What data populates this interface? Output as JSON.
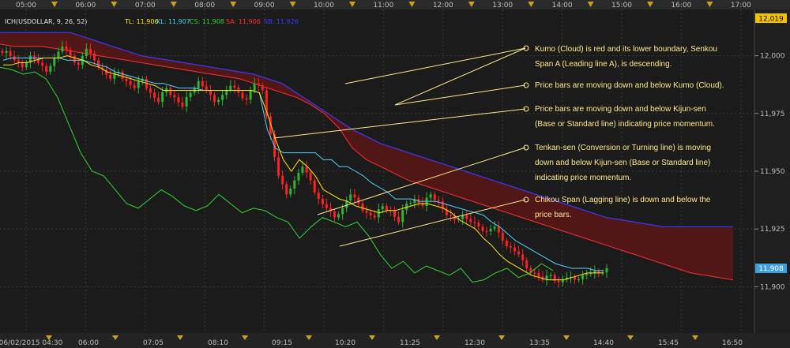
{
  "chart_data": {
    "type": "candlestick",
    "instrument_label": "ICH(USDOLLAR, 9, 26, 52)",
    "indicators": [
      {
        "key": "TL",
        "text": "TL: 11,906",
        "color": "#ffea00"
      },
      {
        "key": "KL",
        "text": "KL: 11,907",
        "color": "#4fd3ff"
      },
      {
        "key": "CS",
        "text": "CS: 11,908",
        "color": "#33d633"
      },
      {
        "key": "SA",
        "text": "SA: 11,906",
        "color": "#ff3030"
      },
      {
        "key": "SB",
        "text": "SB: 11,926",
        "color": "#3a3aff"
      }
    ],
    "top_time_ticks": [
      "05:00",
      "06:00",
      "07:00",
      "08:00",
      "09:00",
      "10:00",
      "11:00",
      "12:00",
      "13:00",
      "14:00",
      "15:00",
      "16:00",
      "17:00"
    ],
    "bottom_time_ticks": [
      "06/02/2015 04:30",
      "06:00",
      "07:05",
      "08:10",
      "09:15",
      "10:20",
      "11:25",
      "12:30",
      "13:35",
      "14:40",
      "15:45",
      "16:50"
    ],
    "y_ticks": [
      "12,000",
      "11,975",
      "11,950",
      "11,925",
      "11,900"
    ],
    "ylim": [
      11880,
      12020
    ],
    "last_price_tags": {
      "top": "12,019",
      "current": "11,908"
    },
    "annotations": [
      {
        "lines": [
          "Kumo (Cloud) is red and its lower boundary, Senkou",
          "Span A (Leading line A), is descending."
        ]
      },
      {
        "lines": [
          "Price bars are moving down and below Kumo (Cloud)."
        ]
      },
      {
        "lines": [
          "Price bars are moving down and below Kijun-sen",
          "(Base or Standard line) indicating price momentum."
        ]
      },
      {
        "lines": [
          "Tenkan-sen (Conversion or Turning line) is moving",
          "down and below Kijun-sen (Base or Standard line)",
          "indicating price momentum."
        ]
      },
      {
        "lines": [
          "Chikou Span (Lagging line) is down and below the",
          "price bars."
        ]
      }
    ],
    "colors": {
      "up": "#2fb52f",
      "down": "#ff2020",
      "cloud": "#5a1515",
      "tenkan": "#ffea00",
      "kijun": "#4fd3ff",
      "chikou": "#33d633",
      "senkou_a": "#ff3030",
      "senkou_b": "#3a3aff",
      "annotation": "#ffe98a"
    },
    "series": {
      "close_path": [
        12002,
        11998,
        11995,
        12000,
        11997,
        11993,
        11999,
        12004,
        12000,
        11996,
        12003,
        11998,
        11994,
        11990,
        11993,
        11989,
        11986,
        11990,
        11984,
        11980,
        11986,
        11982,
        11978,
        11984,
        11989,
        11985,
        11980,
        11983,
        11987,
        11984,
        11981,
        11988,
        11985,
        11966,
        11948,
        11940,
        11946,
        11952,
        11946,
        11938,
        11934,
        11930,
        11934,
        11940,
        11936,
        11932,
        11930,
        11935,
        11933,
        11928,
        11936,
        11938,
        11935,
        11940,
        11937,
        11931,
        11929,
        11931,
        11928,
        11926,
        11924,
        11926,
        11920,
        11917,
        11914,
        11908,
        11906,
        11903,
        11905,
        11902,
        11904,
        11903,
        11905,
        11906,
        11906,
        11908
      ],
      "tenkan": [
        11996,
        11996,
        11997,
        11997,
        11998,
        11999,
        11999,
        11999,
        12000,
        11999,
        11998,
        11996,
        11995,
        11993,
        11992,
        11991,
        11990,
        11989,
        11988,
        11987,
        11985,
        11985,
        11985,
        11985,
        11985,
        11985,
        11985,
        11985,
        11985,
        11985,
        11985,
        11985,
        11984,
        11975,
        11964,
        11955,
        11950,
        11955,
        11952,
        11948,
        11942,
        11940,
        11938,
        11937,
        11935,
        11934,
        11933,
        11932,
        11933,
        11933,
        11934,
        11935,
        11936,
        11936,
        11935,
        11934,
        11932,
        11929,
        11927,
        11925,
        11921,
        11918,
        11914,
        11911,
        11909,
        11907,
        11905,
        11904,
        11903,
        11903,
        11903,
        11904,
        11905,
        11906,
        11906,
        11906
      ],
      "kijun": [
        11998,
        11999,
        11999,
        11999,
        11999,
        11999,
        11999,
        11999,
        11998,
        11998,
        11998,
        11997,
        11996,
        11995,
        11993,
        11992,
        11991,
        11990,
        11989,
        11988,
        11988,
        11987,
        11986,
        11986,
        11986,
        11985,
        11985,
        11985,
        11985,
        11985,
        11985,
        11985,
        11984,
        11968,
        11960,
        11958,
        11958,
        11958,
        11958,
        11958,
        11955,
        11955,
        11952,
        11952,
        11950,
        11948,
        11945,
        11943,
        11941,
        11938,
        11938,
        11938,
        11937,
        11937,
        11937,
        11936,
        11935,
        11934,
        11933,
        11932,
        11931,
        11928,
        11926,
        11923,
        11920,
        11918,
        11916,
        11914,
        11912,
        11910,
        11909,
        11908,
        11908,
        11908,
        11907,
        11907
      ],
      "chikou": [
        11995,
        11994,
        11992,
        11993,
        11990,
        11982,
        11970,
        11958,
        11950,
        11948,
        11942,
        11936,
        11934,
        11938,
        11942,
        11939,
        11935,
        11933,
        11935,
        11940,
        11936,
        11932,
        11934,
        11933,
        11930,
        11928,
        11921,
        11926,
        11930,
        11928,
        11926,
        11928,
        11922,
        11914,
        11908,
        11911,
        11906,
        11909,
        11907,
        11905,
        11908,
        11902,
        11903,
        11906,
        11908,
        11904,
        11906,
        11910,
        11907
      ],
      "senkou_a": [
        12005,
        12004,
        12004,
        12004,
        12003,
        12002,
        12001,
        12000,
        11999,
        11998,
        11997,
        11996,
        11995,
        11994,
        11993,
        11992,
        11991,
        11990,
        11988,
        11986,
        11984,
        11982,
        11979,
        11975,
        11969,
        11960,
        11955,
        11952,
        11949,
        11946,
        11944,
        11942,
        11940,
        11938,
        11936,
        11934,
        11932,
        11930,
        11928,
        11926,
        11924,
        11922,
        11920,
        11918,
        11916,
        11914,
        11912,
        11910,
        11908,
        11906,
        11905,
        11904,
        11903
      ],
      "senkou_b": [
        12010,
        12010,
        12010,
        12010,
        12010,
        12010,
        12008,
        12006,
        12004,
        12002,
        12000,
        11999,
        11998,
        11997,
        11996,
        11995,
        11994,
        11993,
        11992,
        11990,
        11988,
        11984,
        11980,
        11976,
        11972,
        11968,
        11965,
        11962,
        11960,
        11958,
        11956,
        11954,
        11952,
        11950,
        11948,
        11946,
        11944,
        11942,
        11940,
        11938,
        11936,
        11934,
        11932,
        11930,
        11929,
        11928,
        11927,
        11926,
        11926,
        11926,
        11926,
        11926,
        11926
      ]
    }
  }
}
